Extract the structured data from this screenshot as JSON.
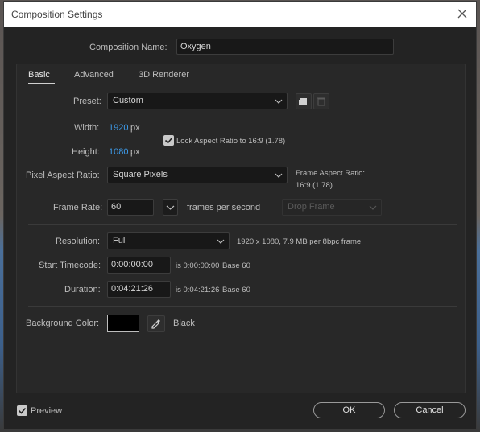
{
  "window": {
    "title": "Composition Settings"
  },
  "composition_name": {
    "label": "Composition Name:",
    "value": "Oxygen"
  },
  "tabs": [
    {
      "label": "Basic",
      "active": true
    },
    {
      "label": "Advanced",
      "active": false
    },
    {
      "label": "3D Renderer",
      "active": false
    }
  ],
  "preset": {
    "label": "Preset:",
    "value": "Custom"
  },
  "width": {
    "label": "Width:",
    "value": "1920",
    "unit": "px"
  },
  "height": {
    "label": "Height:",
    "value": "1080",
    "unit": "px"
  },
  "lock_aspect": {
    "label": "Lock Aspect Ratio to 16:9 (1.78)",
    "checked": true
  },
  "pixel_aspect": {
    "label": "Pixel Aspect Ratio:",
    "value": "Square Pixels"
  },
  "frame_aspect": {
    "line1": "Frame Aspect Ratio:",
    "line2": "16:9 (1.78)"
  },
  "frame_rate": {
    "label": "Frame Rate:",
    "value": "60",
    "unit": "frames per second",
    "drop_frame": "Drop Frame"
  },
  "resolution": {
    "label": "Resolution:",
    "value": "Full",
    "info": "1920 x 1080, 7.9 MB per 8bpc frame"
  },
  "start_timecode": {
    "label": "Start Timecode:",
    "value": "0:00:00:00",
    "is_value": "is 0:00:00:00",
    "base": "Base 60"
  },
  "duration": {
    "label": "Duration:",
    "value": "0:04:21:26",
    "is_value": "is 0:04:21:26",
    "base": "Base 60"
  },
  "background_color": {
    "label": "Background Color:",
    "name": "Black",
    "color": "#000000"
  },
  "footer": {
    "preview_label": "Preview",
    "preview_checked": true,
    "ok_label": "OK",
    "cancel_label": "Cancel"
  },
  "colors": {
    "accent_blue": "#3d9bea",
    "dialog_bg": "#232323",
    "panel_bg": "#282828"
  }
}
